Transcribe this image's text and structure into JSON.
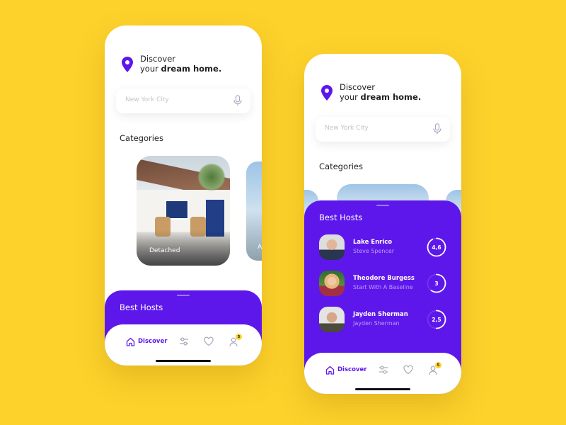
{
  "colors": {
    "background": "#FDD22B",
    "accent": "#5E17EB",
    "badge": "#FDD22B"
  },
  "header": {
    "line1": "Discover",
    "line2_prefix": "your ",
    "line2_bold": "dream home.",
    "icon": "map-pin-icon"
  },
  "search": {
    "placeholder": "New York City",
    "icon": "microphone-icon"
  },
  "categories": {
    "title": "Categories",
    "items": [
      {
        "label": "Detached"
      },
      {
        "label": "A"
      }
    ]
  },
  "best_hosts": {
    "title": "Best Hosts",
    "hosts": [
      {
        "name": "Lake Enrico",
        "subtitle": "Steve Spencer",
        "rating": "4,6",
        "rating_value": 4.6
      },
      {
        "name": "Theodore Burgess",
        "subtitle": "Start With A Baseline",
        "rating": "3",
        "rating_value": 3
      },
      {
        "name": "Jayden Sherman",
        "subtitle": "Jayden Sherman",
        "rating": "2,5",
        "rating_value": 2.5
      }
    ],
    "rating_max": 5
  },
  "nav": {
    "discover_label": "Discover",
    "items": [
      "home-icon",
      "filter-icon",
      "heart-icon",
      "user-icon"
    ],
    "badge": "5"
  }
}
